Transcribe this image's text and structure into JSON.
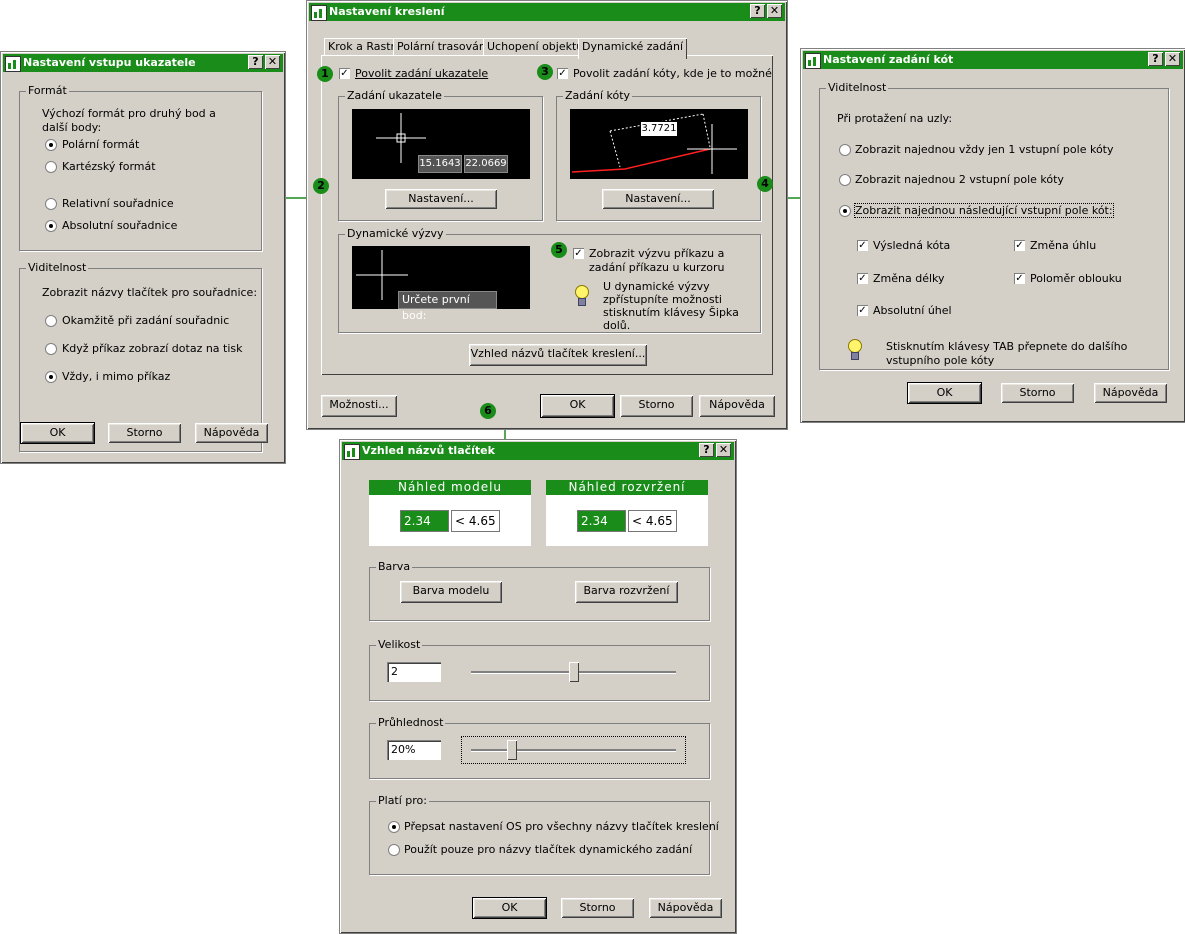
{
  "main": {
    "title": "Nastavení kreslení",
    "tabs": [
      "Krok a Rastr",
      "Polární trasování",
      "Uchopení objektu",
      "Dynamické zadání"
    ],
    "enable_pointer": "Povolit zadání ukazatele",
    "enable_dim": "Povolit zadání kóty, kde je to možné",
    "group_pointer": "Zadání ukazatele",
    "group_dim": "Zadání kóty",
    "group_prompts": "Dynamické výzvy",
    "pointer_preview": {
      "x": "15.1643",
      "y": "22.0669"
    },
    "dim_preview": {
      "value": "3.7721"
    },
    "prompt_preview": "Určete první bod:",
    "settings1": "Nastavení...",
    "settings2": "Nastavení...",
    "show_prompts": "Zobrazit výzvu příkazu a zadání příkazu u kurzoru",
    "tip": "U dynamické výzvy zpřístupníte možnosti stisknutím klávesy Šipka dolů.",
    "tooltip_btn": "Vzhled názvů tlačítek kreslení...",
    "options": "Možnosti...",
    "ok": "OK",
    "cancel": "Storno",
    "help": "Nápověda"
  },
  "markers": [
    "1",
    "2",
    "3",
    "4",
    "5",
    "6"
  ],
  "pointer_dlg": {
    "title": "Nastavení vstupu ukazatele",
    "group_format": "Formát",
    "format_desc": "Výchozí formát pro druhý bod a další body:",
    "polar": "Polární formát",
    "cartesian": "Kartézský formát",
    "relative": "Relativní souřadnice",
    "absolute": "Absolutní souřadnice",
    "group_vis": "Viditelnost",
    "vis_desc": "Zobrazit názvy tlačítek pro souřadnice:",
    "vis1": "Okamžitě při zadání souřadnic",
    "vis2": "Když příkaz zobrazí dotaz na tisk",
    "vis3": "Vždy, i mimo příkaz",
    "ok": "OK",
    "cancel": "Storno",
    "help": "Nápověda"
  },
  "dim_dlg": {
    "title": "Nastavení zadání kót",
    "group_vis": "Viditelnost",
    "stretch_label": "Při protažení na uzly:",
    "opt1": "Zobrazit najednou vždy jen 1 vstupní pole kóty",
    "opt2": "Zobrazit najednou 2 vstupní pole kóty",
    "opt3": "Zobrazit najednou následující vstupní pole kót:",
    "cb1": "Výsledná kóta",
    "cb2": "Změna úhlu",
    "cb3": "Změna délky",
    "cb4": "Poloměr oblouku",
    "cb5": "Absolutní úhel",
    "tip": "Stisknutím klávesy TAB přepnete do dalšího vstupního pole kóty",
    "ok": "OK",
    "cancel": "Storno",
    "help": "Nápověda"
  },
  "tooltip_dlg": {
    "title": "Vzhled názvů tlačítek",
    "model_preview": "Náhled modelu",
    "layout_preview": "Náhled rozvržení",
    "preview_value": "2.34",
    "preview_value2": "< 4.65",
    "group_color": "Barva",
    "model_color": "Barva modelu",
    "layout_color": "Barva rozvržení",
    "group_size": "Velikost",
    "size_value": "2",
    "size_level": 0.5,
    "group_transparency": "Průhlednost",
    "transparency_value": "20%",
    "transparency_level": 0.2,
    "group_apply": "Platí pro:",
    "apply1": "Přepsat nastavení OS pro všechny názvy tlačítek kreslení",
    "apply2": "Použít pouze pro názvy tlačítek dynamického zadání",
    "ok": "OK",
    "cancel": "Storno",
    "help": "Nápověda"
  },
  "colors": {
    "accent": "#1a8c1a",
    "title_text": "#ffffff",
    "dialog_bg": "#d4d0c8"
  }
}
